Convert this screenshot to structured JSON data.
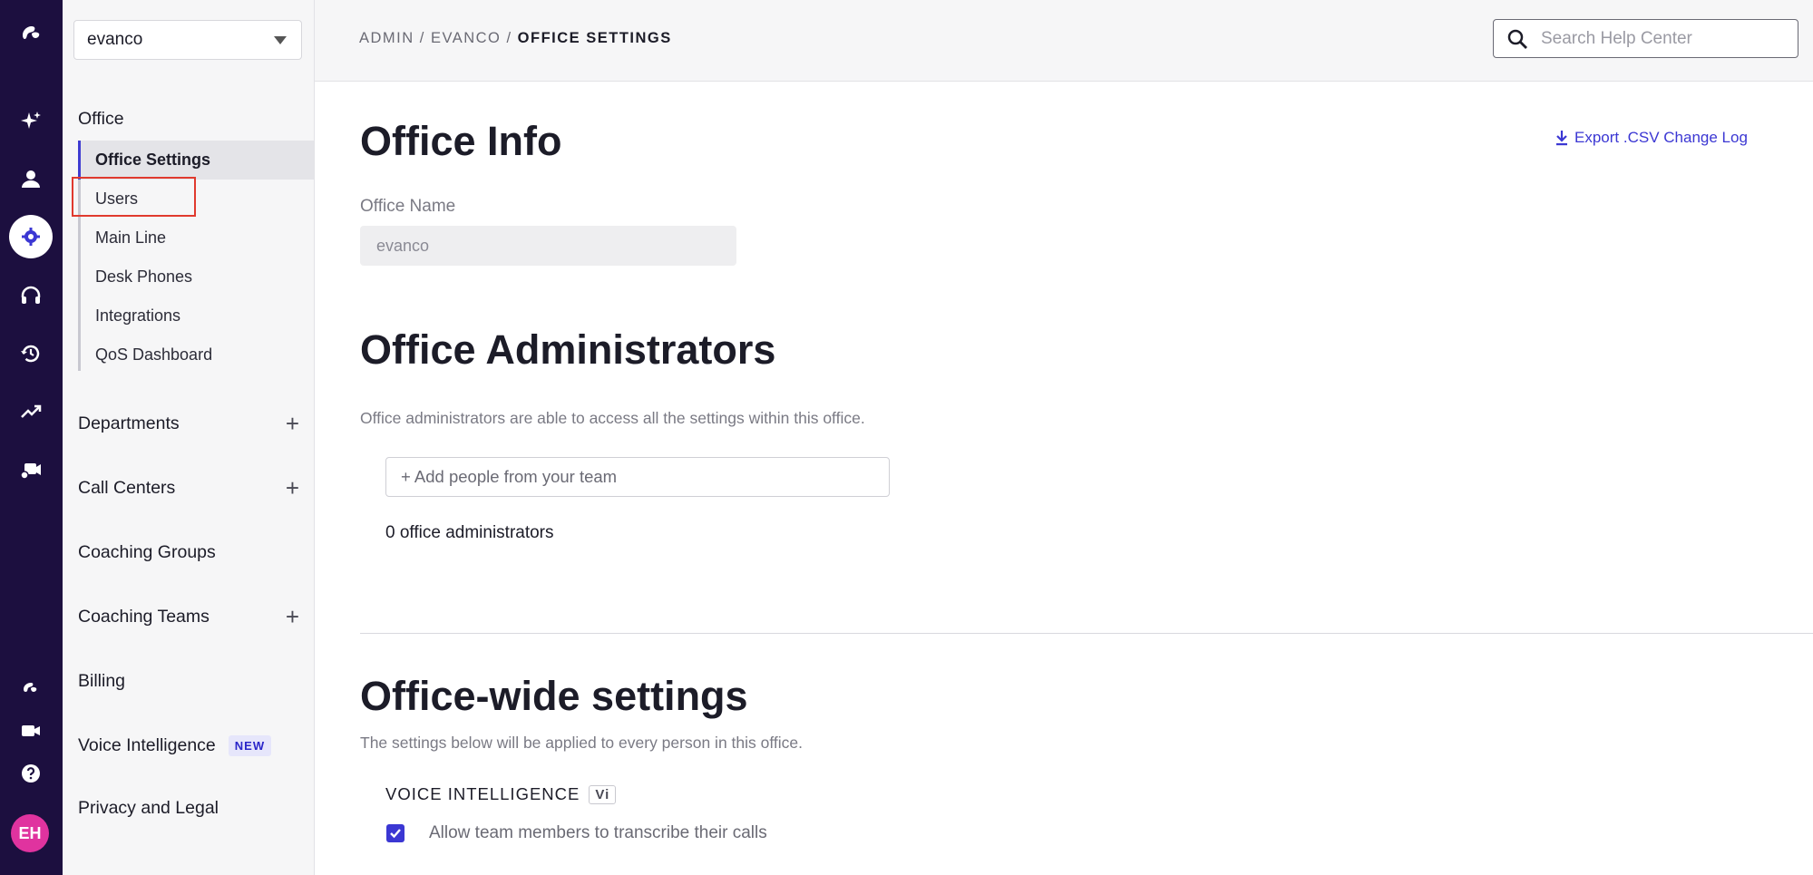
{
  "rail": {
    "items": [
      {
        "name": "logo-icon"
      },
      {
        "name": "ai-sparkle-icon"
      },
      {
        "name": "person-icon"
      },
      {
        "name": "settings-gear-icon",
        "active": true
      },
      {
        "name": "headset-icon"
      },
      {
        "name": "history-icon"
      },
      {
        "name": "trend-chart-icon"
      },
      {
        "name": "video-settings-icon"
      },
      {
        "name": "dialpad-logo-icon"
      },
      {
        "name": "video-camera-icon"
      },
      {
        "name": "help-icon"
      }
    ],
    "avatar_initials": "EH",
    "colors": {
      "rail_bg": "#1c0f3f",
      "avatar_bg": "#e0339f",
      "accent": "#3b37d3"
    }
  },
  "sidebar": {
    "org_select_value": "evanco",
    "office_heading": "Office",
    "office_items": [
      {
        "label": "Office Settings",
        "selected": true
      },
      {
        "label": "Users"
      },
      {
        "label": "Main Line"
      },
      {
        "label": "Desk Phones"
      },
      {
        "label": "Integrations"
      },
      {
        "label": "QoS Dashboard"
      }
    ],
    "sections": [
      {
        "label": "Departments",
        "has_add": true
      },
      {
        "label": "Call Centers",
        "has_add": true
      },
      {
        "label": "Coaching Groups",
        "has_add": false
      },
      {
        "label": "Coaching Teams",
        "has_add": true
      },
      {
        "label": "Billing",
        "has_add": false
      },
      {
        "label": "Voice Intelligence",
        "badge": "NEW"
      },
      {
        "label": "Privacy and Legal"
      }
    ],
    "plus_symbol": "+"
  },
  "header": {
    "breadcrumb": {
      "part1": "ADMIN",
      "sep": " / ",
      "part2": "EVANCO",
      "current": "OFFICE SETTINGS"
    },
    "search_placeholder": "Search Help Center"
  },
  "main": {
    "office_info_title": "Office Info",
    "export_label": "Export .CSV Change Log",
    "office_name_label": "Office Name",
    "office_name_value": "evanco",
    "admins_title": "Office Administrators",
    "admins_help": "Office administrators are able to access all the settings within this office.",
    "add_people_placeholder": "+ Add people from your team",
    "admins_count": "0 office administrators",
    "office_wide_title": "Office-wide settings",
    "office_wide_help": "The settings below will be applied to every person in this office.",
    "voice_intel_label": "VOICE INTELLIGENCE",
    "voice_intel_tag": "Vi",
    "transcribe_label": "Allow team members to transcribe their calls",
    "transcribe_checked": true
  }
}
